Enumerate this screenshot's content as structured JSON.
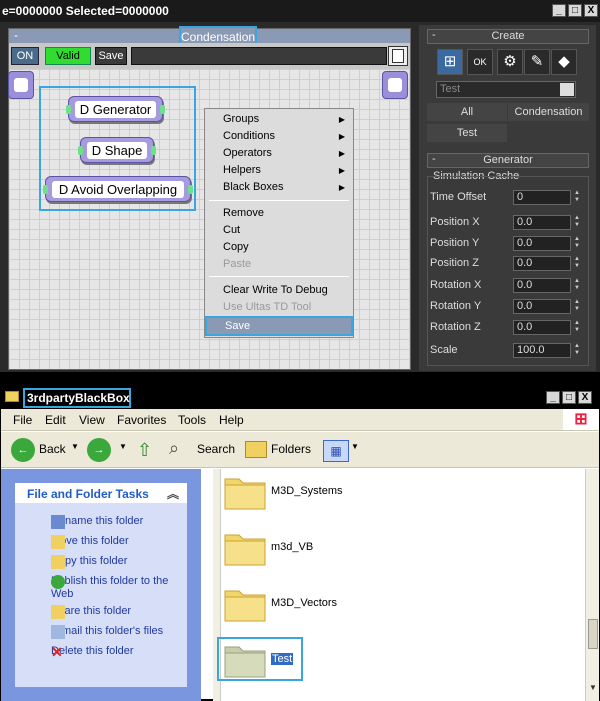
{
  "top": {
    "title": "e=0000000  Selected=0000000",
    "buttons": [
      "_",
      "□",
      "X"
    ]
  },
  "editor": {
    "title": "Condensation",
    "dash": "-",
    "on_label": "ON",
    "valid_label": "Valid",
    "save_label": "Save",
    "nodes": [
      "D Generator",
      "D Shape",
      "D Avoid Overlapping"
    ]
  },
  "context_menu": {
    "items": [
      {
        "label": "Groups",
        "submenu": true
      },
      {
        "label": "Conditions",
        "submenu": true
      },
      {
        "label": "Operators",
        "submenu": true
      },
      {
        "label": "Helpers",
        "submenu": true
      },
      {
        "label": "Black Boxes",
        "submenu": true
      },
      {
        "label": "Remove"
      },
      {
        "label": "Cut"
      },
      {
        "label": "Copy"
      },
      {
        "label": "Paste",
        "disabled": true
      },
      {
        "label": "Clear Write To Debug"
      },
      {
        "label": "Use Ultas TD Tool",
        "disabled": true
      },
      {
        "label": "Save",
        "selected": true
      }
    ]
  },
  "right_panel": {
    "create_title": "Create",
    "dash": "-",
    "icons": [
      "create-node-icon",
      "ok-icon",
      "gear-icon",
      "wrench-icon",
      "box-icon"
    ],
    "test_field": "Test",
    "all_button": "All",
    "condensation_button": "Condensation",
    "test_button": "Test",
    "generator_title": "Generator",
    "sim_cache": "Simulation Cache",
    "params": [
      {
        "label": "Time Offset",
        "value": "0"
      },
      {
        "label": "Position X",
        "value": "0.0"
      },
      {
        "label": "Position Y",
        "value": "0.0"
      },
      {
        "label": "Position Z",
        "value": "0.0"
      },
      {
        "label": "Rotation X",
        "value": "0.0"
      },
      {
        "label": "Rotation Y",
        "value": "0.0"
      },
      {
        "label": "Rotation Z",
        "value": "0.0"
      },
      {
        "label": "Scale",
        "value": "100.0"
      }
    ]
  },
  "explorer": {
    "title": "3rdpartyBlackBox",
    "menu": [
      "File",
      "Edit",
      "View",
      "Favorites",
      "Tools",
      "Help"
    ],
    "toolbar": {
      "back": "Back",
      "search": "Search",
      "folders": "Folders"
    },
    "tasks_title": "File and Folder Tasks",
    "tasks": [
      "Rename this folder",
      "Move this folder",
      "Copy this folder",
      "Publish this folder to the Web",
      "Share this folder",
      "E-mail this folder's files",
      "Delete this folder"
    ],
    "folders": [
      "M3D_Systems",
      "m3d_VB",
      "M3D_Vectors",
      "Test"
    ]
  }
}
